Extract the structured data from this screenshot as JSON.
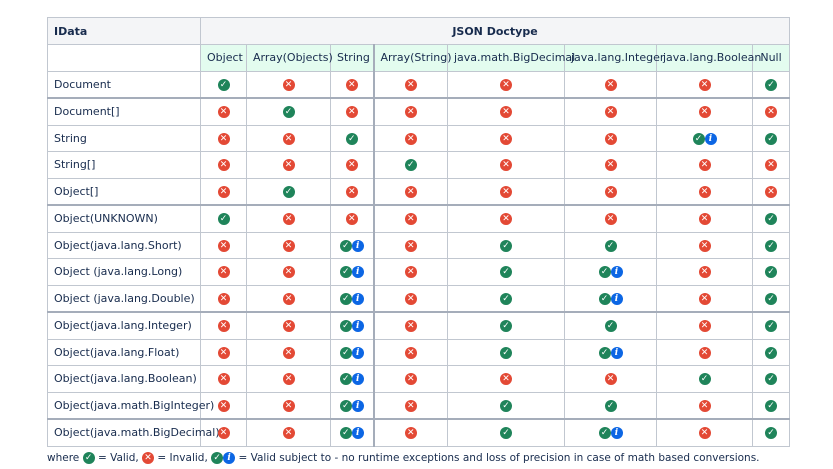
{
  "table": {
    "corner_label": "IData",
    "group_header": "JSON Doctype",
    "columns": [
      "Object",
      "Array(Objects)",
      "String",
      "Array(String)",
      "java.math.BigDecimal",
      "java.lang.Integer",
      "java.lang.Boolean",
      "Null"
    ],
    "rows": [
      {
        "label": "Document",
        "cells": [
          "ok",
          "bad",
          "bad",
          "bad",
          "bad",
          "bad",
          "bad",
          "ok"
        ]
      },
      {
        "label": "Document[]",
        "cells": [
          "bad",
          "ok",
          "bad",
          "bad",
          "bad",
          "bad",
          "bad",
          "bad"
        ]
      },
      {
        "label": "String",
        "cells": [
          "bad",
          "bad",
          "ok",
          "bad",
          "bad",
          "bad",
          "okinfo",
          "ok"
        ]
      },
      {
        "label": "String[]",
        "cells": [
          "bad",
          "bad",
          "bad",
          "ok",
          "bad",
          "bad",
          "bad",
          "bad"
        ]
      },
      {
        "label": "Object[]",
        "cells": [
          "bad",
          "ok",
          "bad",
          "bad",
          "bad",
          "bad",
          "bad",
          "bad"
        ]
      },
      {
        "label": "Object(UNKNOWN)",
        "cells": [
          "ok",
          "bad",
          "bad",
          "bad",
          "bad",
          "bad",
          "bad",
          "ok"
        ]
      },
      {
        "label": "Object(java.lang.Short)",
        "cells": [
          "bad",
          "bad",
          "okinfo",
          "bad",
          "ok",
          "ok",
          "bad",
          "ok"
        ]
      },
      {
        "label": "Object (java.lang.Long)",
        "cells": [
          "bad",
          "bad",
          "okinfo",
          "bad",
          "ok",
          "okinfo",
          "bad",
          "ok"
        ]
      },
      {
        "label": "Object (java.lang.Double)",
        "cells": [
          "bad",
          "bad",
          "okinfo",
          "bad",
          "ok",
          "okinfo",
          "bad",
          "ok"
        ]
      },
      {
        "label": "Object(java.lang.Integer)",
        "cells": [
          "bad",
          "bad",
          "okinfo",
          "bad",
          "ok",
          "ok",
          "bad",
          "ok"
        ]
      },
      {
        "label": "Object(java.lang.Float)",
        "cells": [
          "bad",
          "bad",
          "okinfo",
          "bad",
          "ok",
          "okinfo",
          "bad",
          "ok"
        ]
      },
      {
        "label": "Object(java.lang.Boolean)",
        "cells": [
          "bad",
          "bad",
          "okinfo",
          "bad",
          "bad",
          "bad",
          "ok",
          "ok"
        ]
      },
      {
        "label": "Object(java.math.BigInteger)",
        "cells": [
          "bad",
          "bad",
          "okinfo",
          "bad",
          "ok",
          "ok",
          "bad",
          "ok"
        ]
      },
      {
        "label": "Object(java.math.BigDecimal)",
        "cells": [
          "bad",
          "bad",
          "okinfo",
          "bad",
          "ok",
          "okinfo",
          "bad",
          "ok"
        ]
      }
    ]
  },
  "legend": {
    "prefix": "where",
    "valid": "= Valid,",
    "invalid": "= Invalid,",
    "valid_subject": "= Valid subject to -  no runtime exceptions and loss of precision in case of math based conversions."
  },
  "icons": {
    "ok": "check-circle-icon",
    "bad": "cross-circle-icon",
    "info": "info-circle-icon"
  },
  "colors": {
    "ok": "#1f845a",
    "bad": "#e34935",
    "info": "#0c66e4",
    "header_bg": "#e3fcef"
  }
}
